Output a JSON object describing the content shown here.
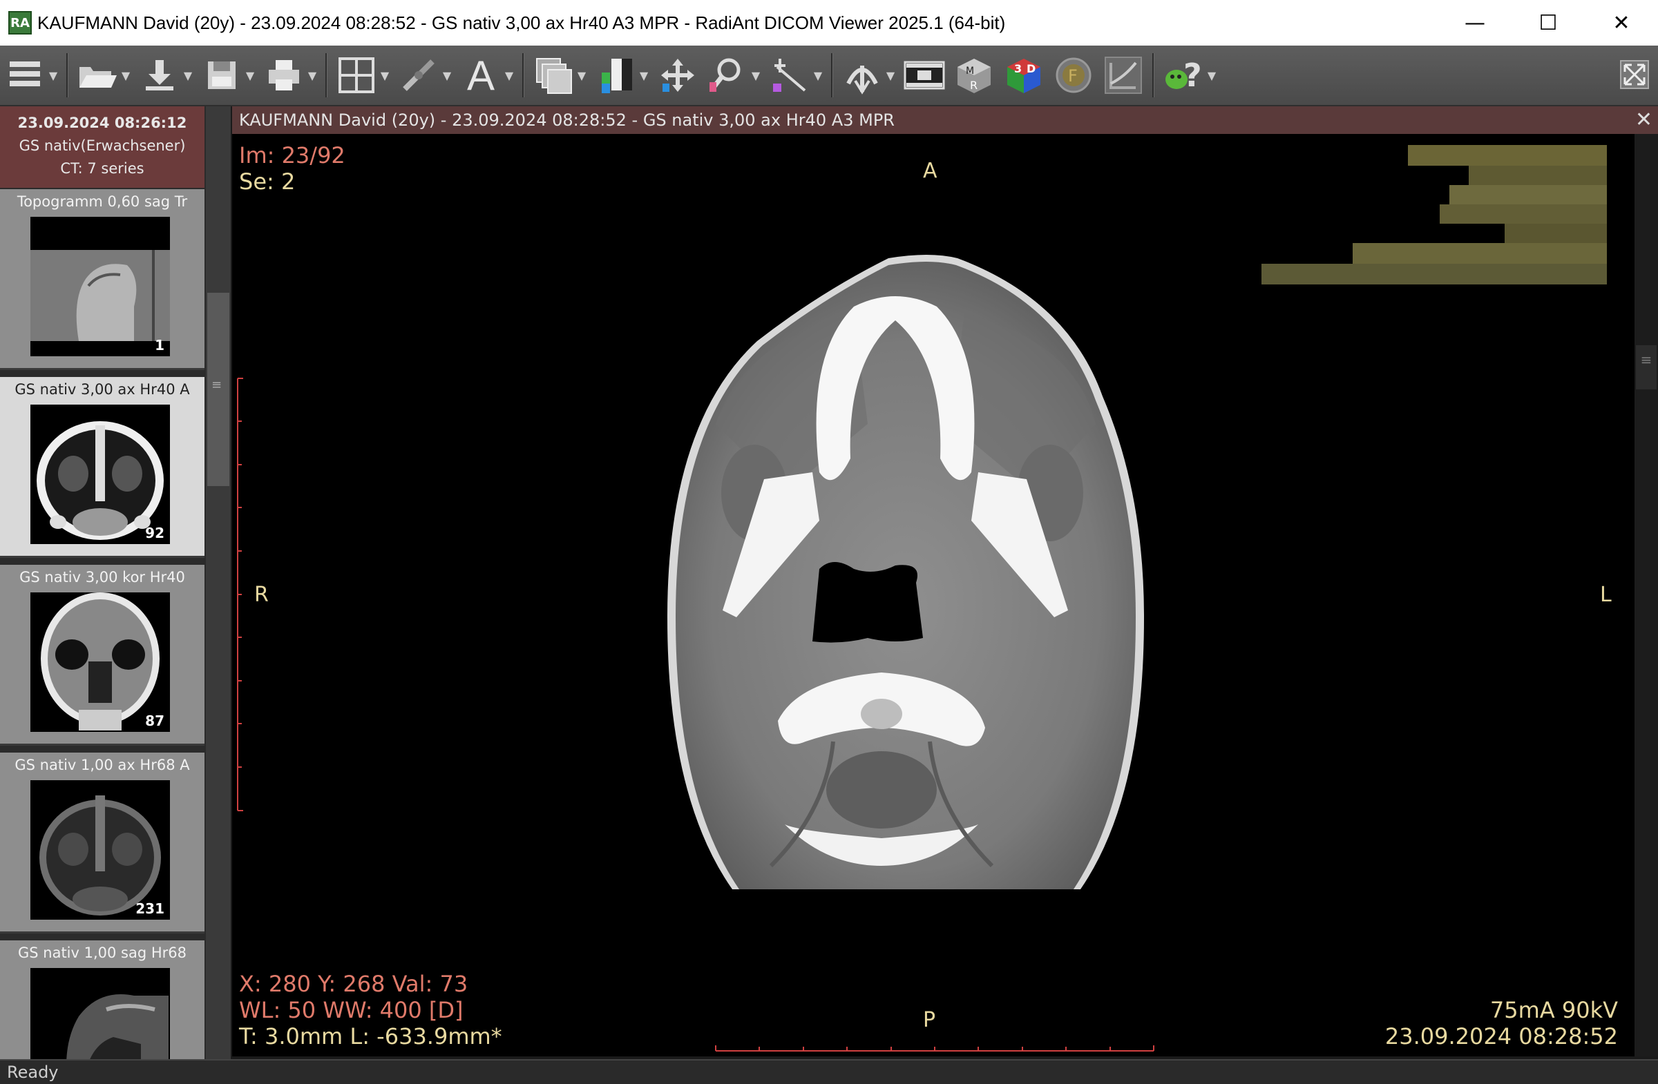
{
  "window": {
    "title": "KAUFMANN David (20y) - 23.09.2024 08:28:52 - GS nativ 3,00 ax Hr40 A3 MPR - RadiAnt DICOM Viewer 2025.1 (64-bit)",
    "app_icon_text": "RA",
    "minimize": "—",
    "maximize": "☐",
    "close": "✕"
  },
  "toolbar": {
    "icons": [
      "menu-icon",
      "open-folder-icon",
      "download-icon",
      "save-icon",
      "print-icon",
      "layout-grid-icon",
      "link-icon",
      "annotation-text-icon",
      "series-stack-icon",
      "window-level-icon",
      "pan-icon",
      "zoom-icon",
      "measure-icon",
      "fusion-icon",
      "cine-icon",
      "mpr-icon",
      "3d-icon",
      "flag-icon",
      "curve-icon",
      "help-icon",
      "fullscreen-icon"
    ]
  },
  "study": {
    "date": "23.09.2024 08:26:12",
    "description": "GS nativ(Erwachsener)",
    "modality_series": "CT: 7 series"
  },
  "series": [
    {
      "label": "Topogramm 0,60 sag Tr",
      "count": "1"
    },
    {
      "label": "GS nativ 3,00 ax Hr40 A",
      "count": "92"
    },
    {
      "label": "GS nativ 3,00 kor Hr40",
      "count": "87"
    },
    {
      "label": "GS nativ 1,00 ax Hr68 A",
      "count": "231"
    },
    {
      "label": "GS nativ 1,00 sag Hr68",
      "count": ""
    }
  ],
  "viewer": {
    "header": "KAUFMANN David  (20y) - 23.09.2024 08:28:52 - GS nativ 3,00 ax Hr40 A3 MPR",
    "close": "✕",
    "image_index": "Im: 23/92",
    "series_index": "Se: 2",
    "orient_top": "A",
    "orient_bottom": "P",
    "orient_left": "R",
    "orient_right": "L",
    "cursor": "X: 280 Y: 268 Val: 73",
    "window": "WL: 50 WW: 400 [D]",
    "slice": "T: 3.0mm L: -633.9mm*",
    "exposure": "75mA 90kV",
    "acq_datetime": "23.09.2024 08:28:52"
  },
  "status": {
    "text": "Ready"
  }
}
